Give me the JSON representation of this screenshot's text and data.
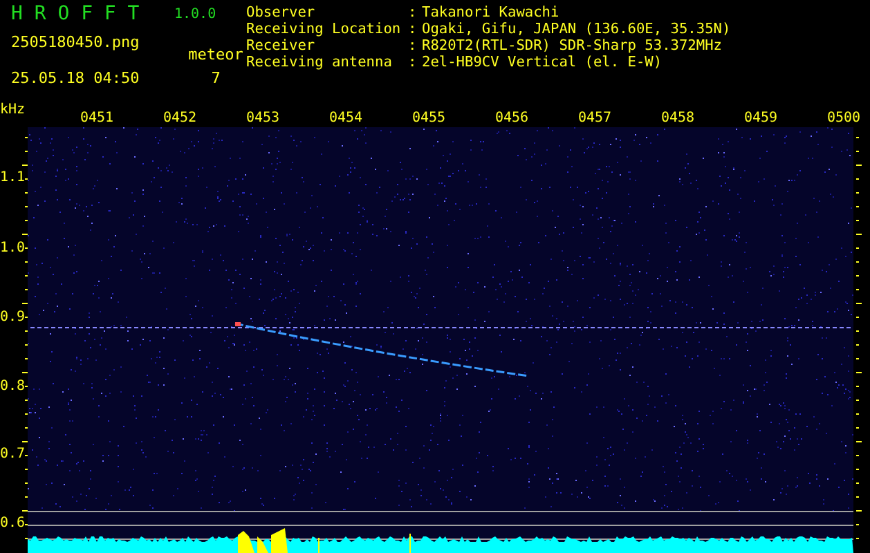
{
  "header": {
    "app_name": "H R O F F T",
    "version": "1.0.0",
    "filename": "2505180450.png",
    "datetime": "25.05.18 04:50",
    "meteor_label": "meteor",
    "meteor_count": "7"
  },
  "info": [
    {
      "label": "Observer",
      "separator": ":",
      "value": "Takanori Kawachi"
    },
    {
      "label": "Receiving Location",
      "separator": ":",
      "value": "Ogaki, Gifu, JAPAN (136.60E, 35.35N)"
    },
    {
      "label": "Receiver",
      "separator": ":",
      "value": "R820T2(RTL-SDR) SDR-Sharp 53.372MHz"
    },
    {
      "label": "Receiving antenna",
      "separator": ":",
      "value": "2el-HB9CV Vertical (el. E-W)"
    }
  ],
  "plot": {
    "unit": "kHz",
    "time_labels": [
      "0451",
      "0452",
      "0453",
      "0454",
      "0455",
      "0456",
      "0457",
      "0458",
      "0459",
      "0500"
    ],
    "freq_labels": [
      "1.1",
      "1.0",
      "0.9",
      "0.8",
      "0.7",
      "0.6"
    ]
  }
}
